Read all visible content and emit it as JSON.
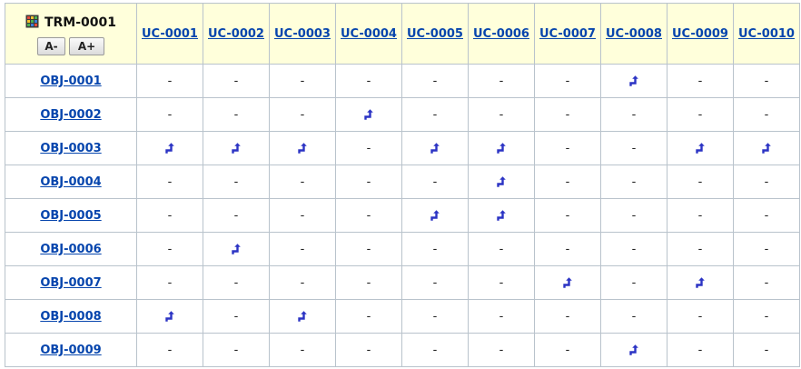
{
  "matrix": {
    "title": "TRM-0001",
    "zoom_out_label": "A-",
    "zoom_in_label": "A+",
    "columns": [
      "UC-0001",
      "UC-0002",
      "UC-0003",
      "UC-0004",
      "UC-0005",
      "UC-0006",
      "UC-0007",
      "UC-0008",
      "UC-0009",
      "UC-0010"
    ],
    "empty_symbol": "-",
    "rows": [
      {
        "label": "OBJ-0001",
        "links": [
          8
        ]
      },
      {
        "label": "OBJ-0002",
        "links": [
          4
        ]
      },
      {
        "label": "OBJ-0003",
        "links": [
          1,
          2,
          3,
          5,
          6,
          9,
          10
        ]
      },
      {
        "label": "OBJ-0004",
        "links": [
          6
        ]
      },
      {
        "label": "OBJ-0005",
        "links": [
          5,
          6
        ]
      },
      {
        "label": "OBJ-0006",
        "links": [
          2
        ]
      },
      {
        "label": "OBJ-0007",
        "links": [
          7,
          9
        ]
      },
      {
        "label": "OBJ-0008",
        "links": [
          1,
          3
        ]
      },
      {
        "label": "OBJ-0009",
        "links": [
          8
        ]
      }
    ],
    "colors": {
      "header_bg": "#ffffdb",
      "link": "#0645ad",
      "grid": "#b9c3cc",
      "arrow": "#2b33c4"
    },
    "icons": {
      "title_icon": "matrix-grid-icon",
      "trace_icon": "trace-arrow-icon"
    }
  }
}
